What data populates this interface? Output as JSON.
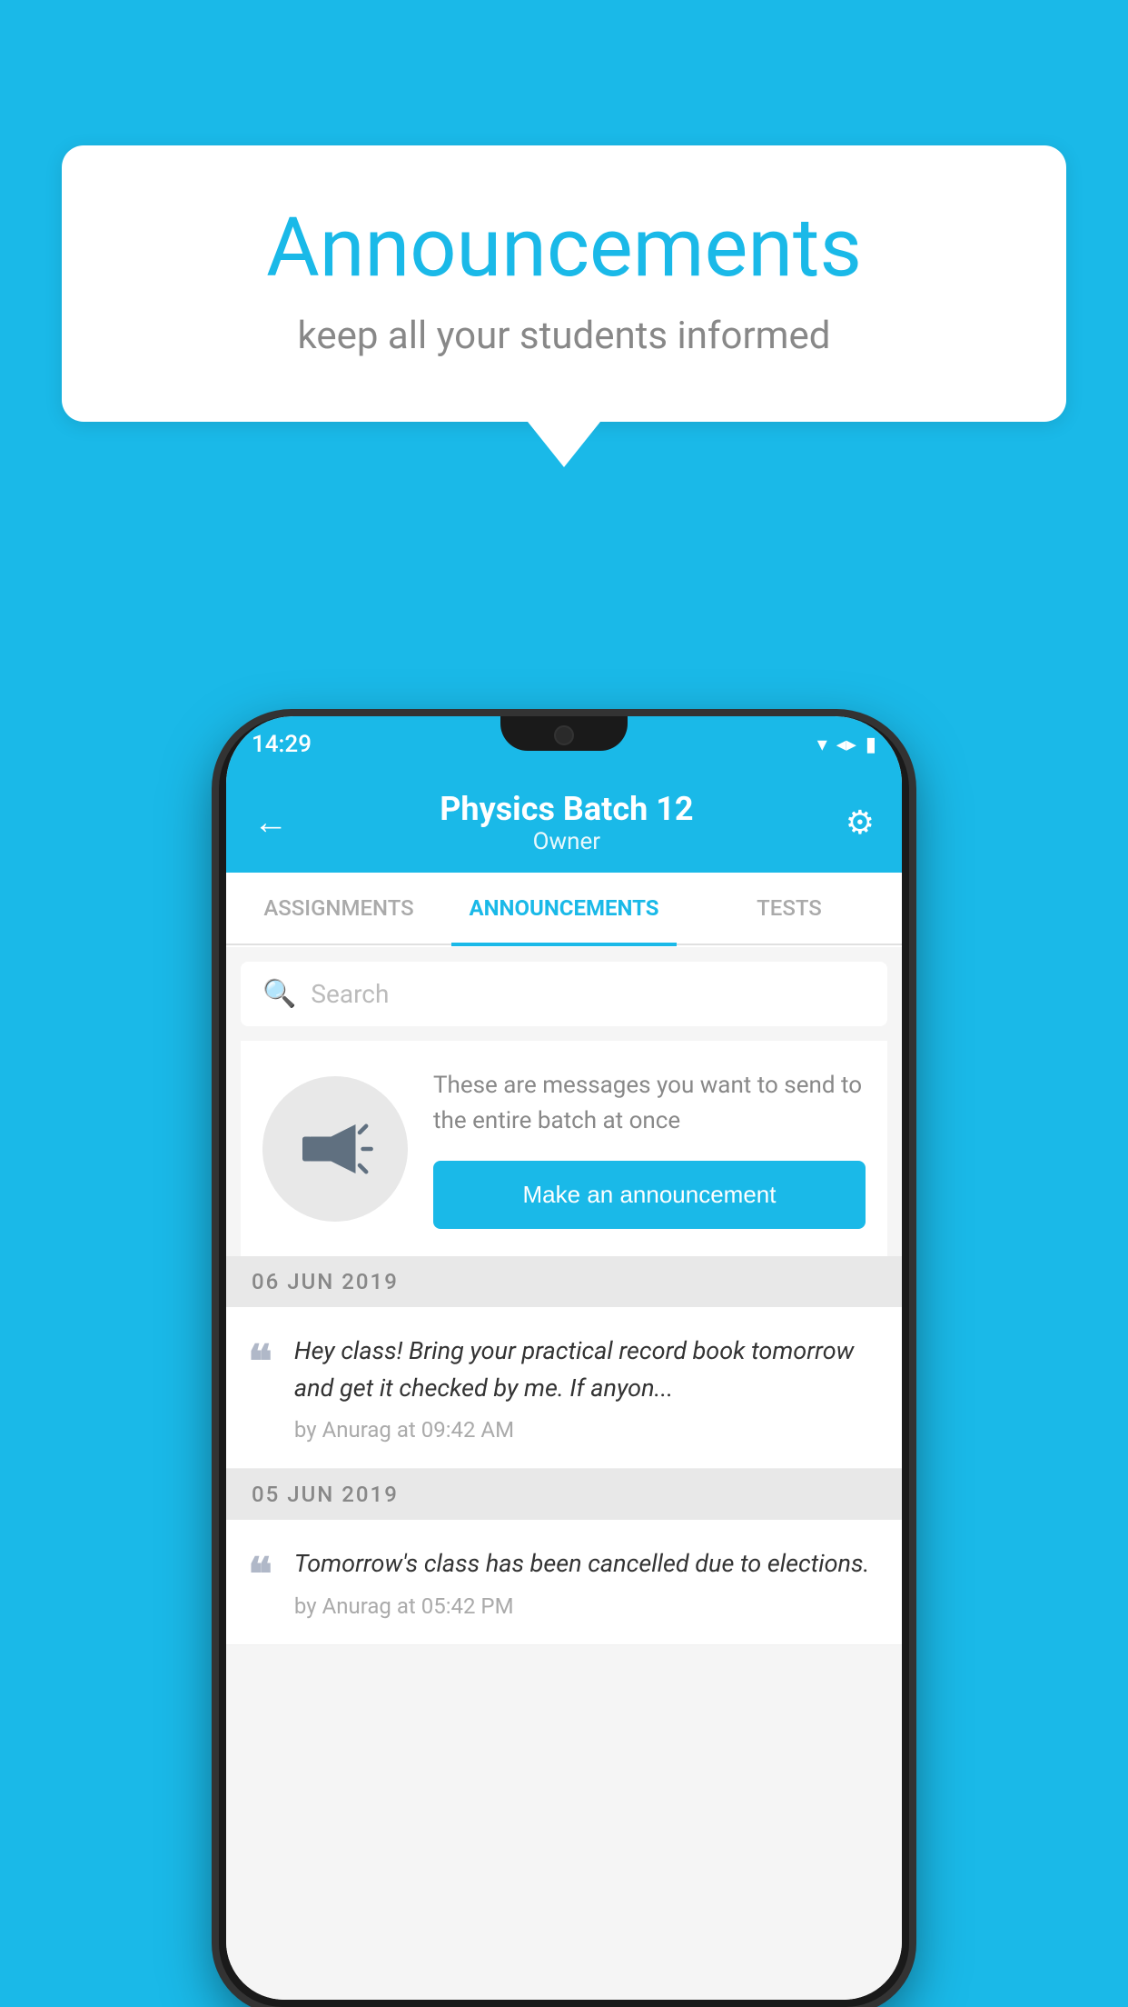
{
  "background_color": "#1ab9e8",
  "bubble": {
    "title": "Announcements",
    "subtitle": "keep all your students informed"
  },
  "status_bar": {
    "time": "14:29",
    "wifi": "▼",
    "signal": "▲",
    "battery": "▮"
  },
  "header": {
    "title": "Physics Batch 12",
    "subtitle": "Owner",
    "back_label": "←",
    "settings_label": "⚙"
  },
  "tabs": [
    {
      "label": "ASSIGNMENTS",
      "active": false
    },
    {
      "label": "ANNOUNCEMENTS",
      "active": true
    },
    {
      "label": "TESTS",
      "active": false
    }
  ],
  "search": {
    "placeholder": "Search"
  },
  "cta": {
    "description": "These are messages you want to send to the entire batch at once",
    "button_label": "Make an announcement"
  },
  "dates": [
    {
      "label": "06  JUN  2019",
      "items": [
        {
          "message": "Hey class! Bring your practical record book tomorrow and get it checked by me. If anyon...",
          "author": "by Anurag at 09:42 AM"
        }
      ]
    },
    {
      "label": "05  JUN  2019",
      "items": [
        {
          "message": "Tomorrow's class has been cancelled due to elections.",
          "author": "by Anurag at 05:42 PM"
        }
      ]
    }
  ]
}
